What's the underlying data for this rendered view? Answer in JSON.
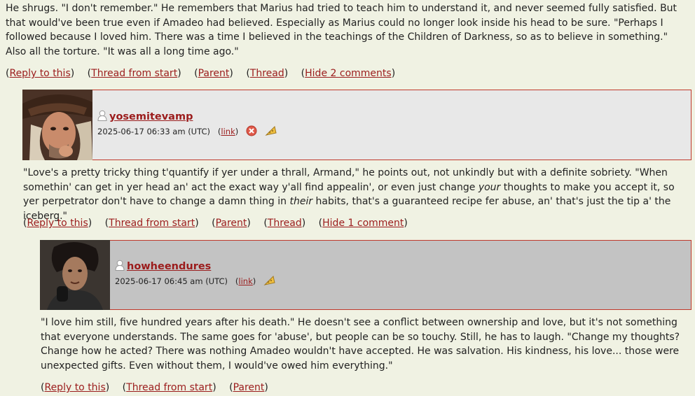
{
  "top_comment": {
    "text_1": "He shrugs. \"I don't remember.\" He remembers that Marius had tried to teach him to understand it, and never seemed fully satisfied. But that would've been true even if Amadeo had believed. Especially as Marius could no longer look inside his head to be sure. \"Perhaps I followed because I loved him. There was a time I believed in the teachings of the Children of Darkness, so as to believe in something.\" Also all the torture. \"It was all a long time ago.\"",
    "links": {
      "reply": "Reply to this",
      "thread_start": "Thread from start",
      "parent": "Parent",
      "thread": "Thread",
      "hide": "Hide 2 comments"
    }
  },
  "comment_1": {
    "username": "yosemitevamp",
    "timestamp": "2025-06-17 06:33 am (UTC)",
    "link_label": "link",
    "text_before_your": "\"Love's a pretty tricky thing t'quantify if yer under a thrall, Armand,\" he points out, not unkindly but with a definite sobriety. \"When somethin' can get in yer head an' act the exact way y'all find appealin', or even just change ",
    "em_your": "your",
    "text_mid": " thoughts to make you accept it, so yer perpetrator don't have to change a damn thing in ",
    "em_their": "their",
    "text_after": " habits, that's a guaranteed recipe fer abuse, an' that's just the tip a' the iceberg.\"",
    "links": {
      "reply": "Reply to this",
      "thread_start": "Thread from start",
      "parent": "Parent",
      "thread": "Thread",
      "hide": "Hide 1 comment"
    },
    "header_bg": "#e8e8e8"
  },
  "comment_2": {
    "username": "howheendures",
    "timestamp": "2025-06-17 06:45 am (UTC)",
    "link_label": "link",
    "text": "\"I love him still, five hundred years after his death.\" He doesn't see a conflict between ownership and love, but it's not something that everyone understands. The same goes for 'abuse', but people can be so touchy. Still, he has to laugh. \"Change my thoughts? Change how he acted? There was nothing Amadeo wouldn't have accepted. He was salvation. His kindness, his love... those were unexpected gifts. Even without them, I would've owed him everything.\"",
    "links": {
      "reply": "Reply to this",
      "thread_start": "Thread from start",
      "parent": "Parent"
    },
    "header_bg": "#c3c3c3"
  },
  "colors": {
    "page_bg": "#f0f2e3",
    "link": "#9b1c1c",
    "border": "#c0392b"
  },
  "icons": [
    "user-icon",
    "delete-icon",
    "screen-icon"
  ]
}
